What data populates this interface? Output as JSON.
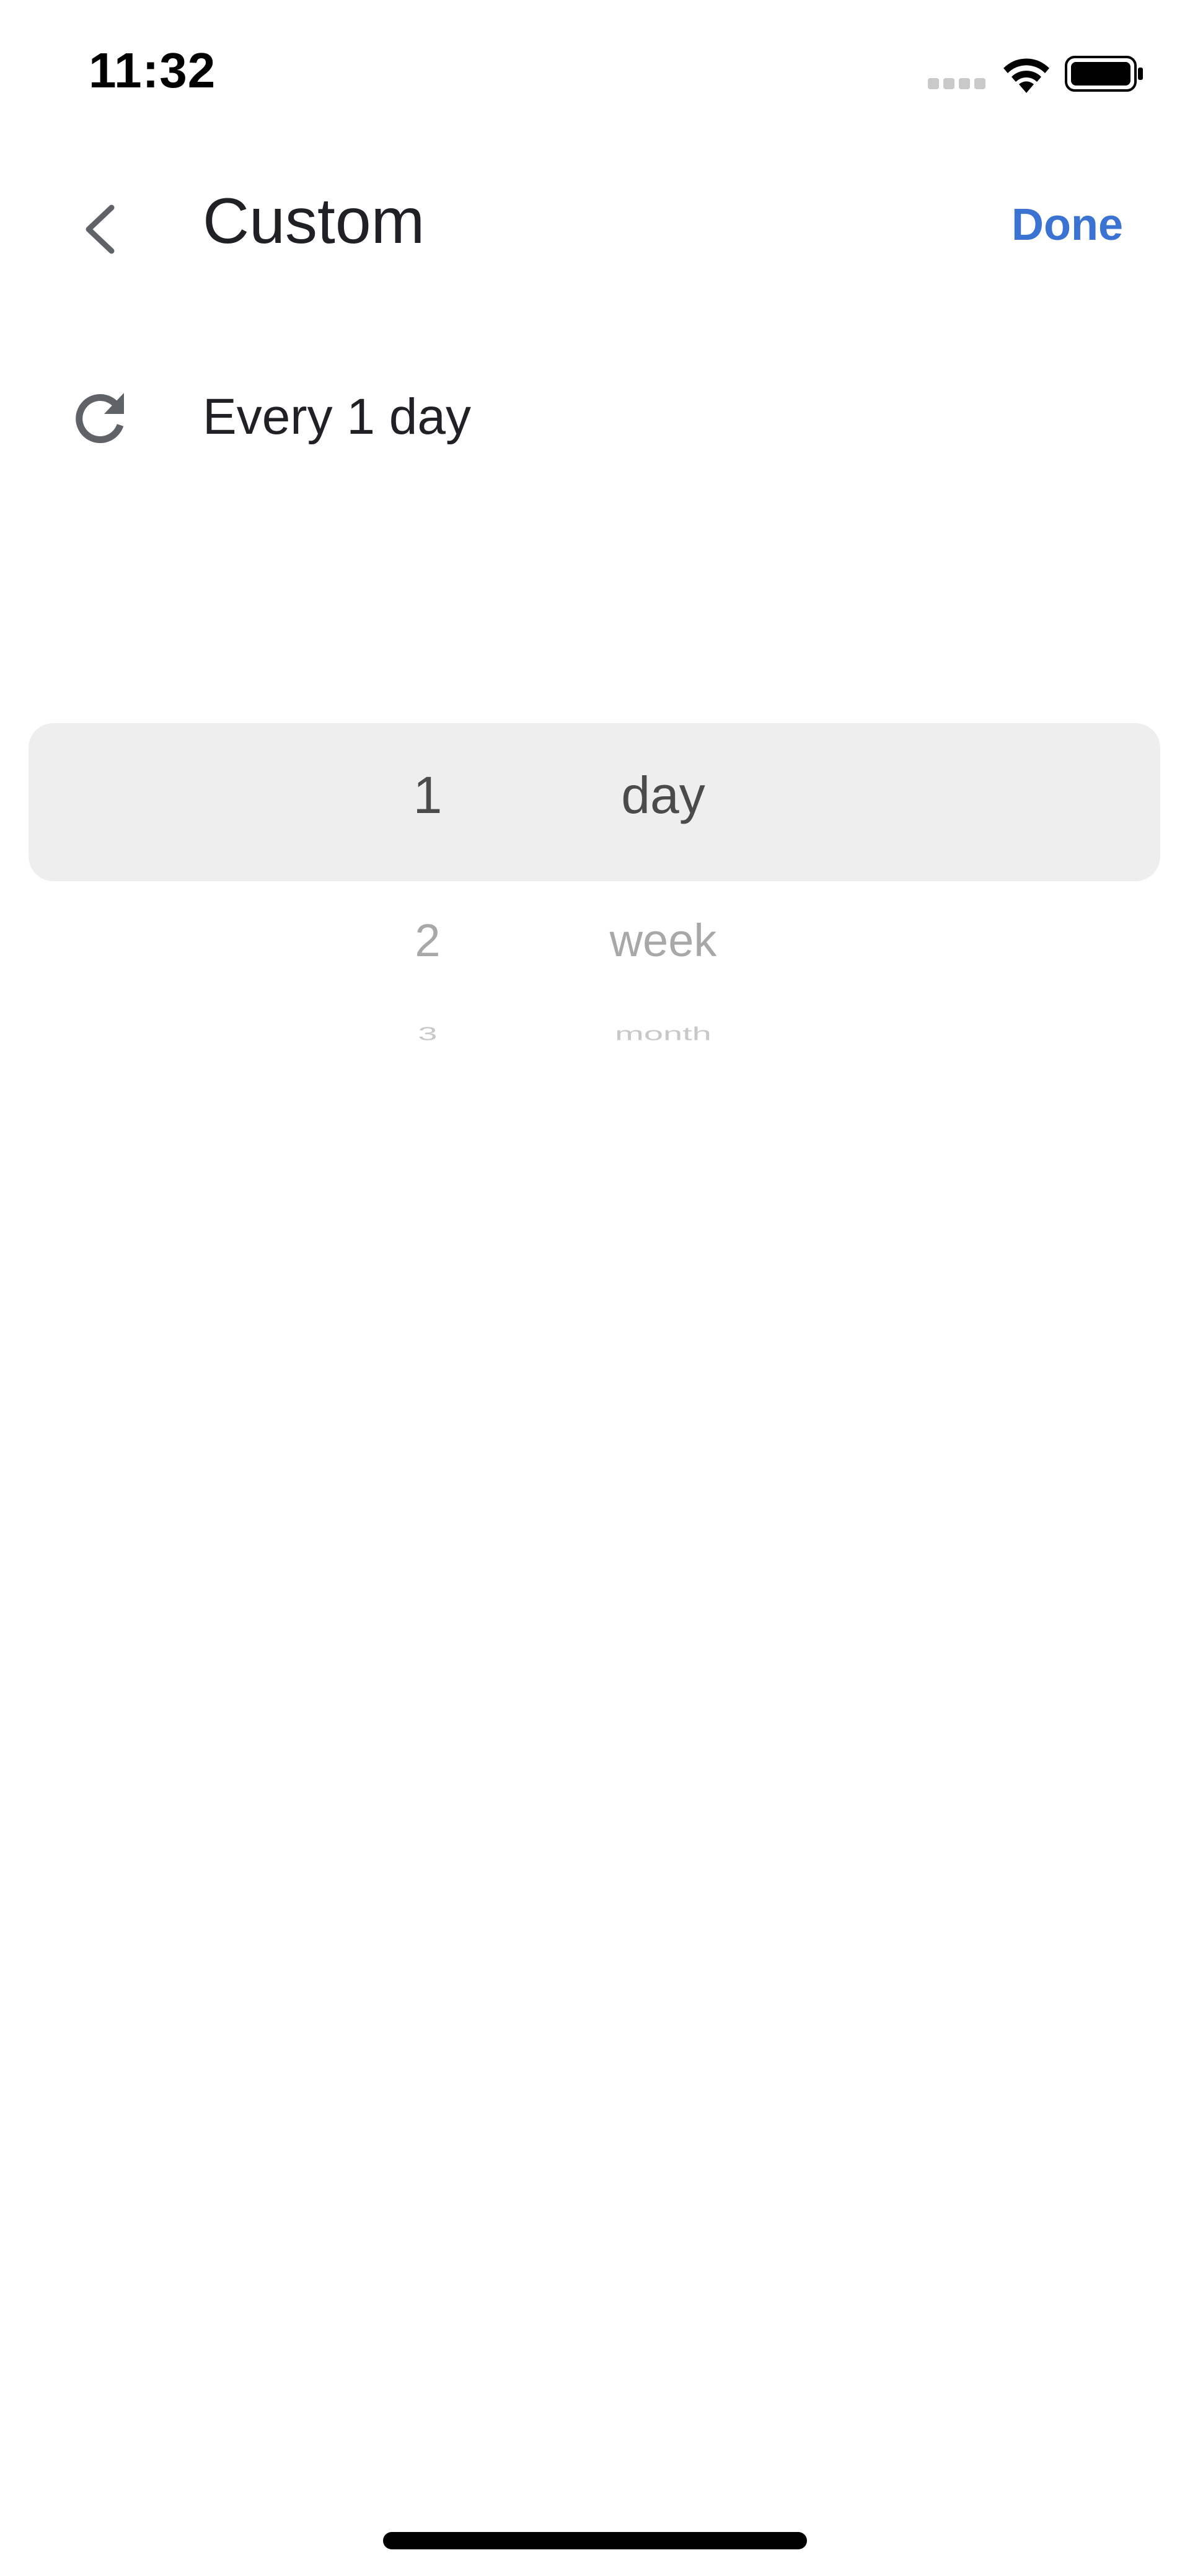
{
  "status_bar": {
    "time": "11:32"
  },
  "header": {
    "title": "Custom",
    "done_label": "Done"
  },
  "repeat": {
    "summary": "Every 1 day"
  },
  "picker": {
    "numbers": [
      "1",
      "2",
      "3"
    ],
    "units": [
      "day",
      "week",
      "month"
    ],
    "selected_number": "1",
    "selected_unit": "day"
  },
  "colors": {
    "accent": "#3b73d3",
    "picker_highlight": "#eeeeee",
    "text_primary": "#202124"
  }
}
